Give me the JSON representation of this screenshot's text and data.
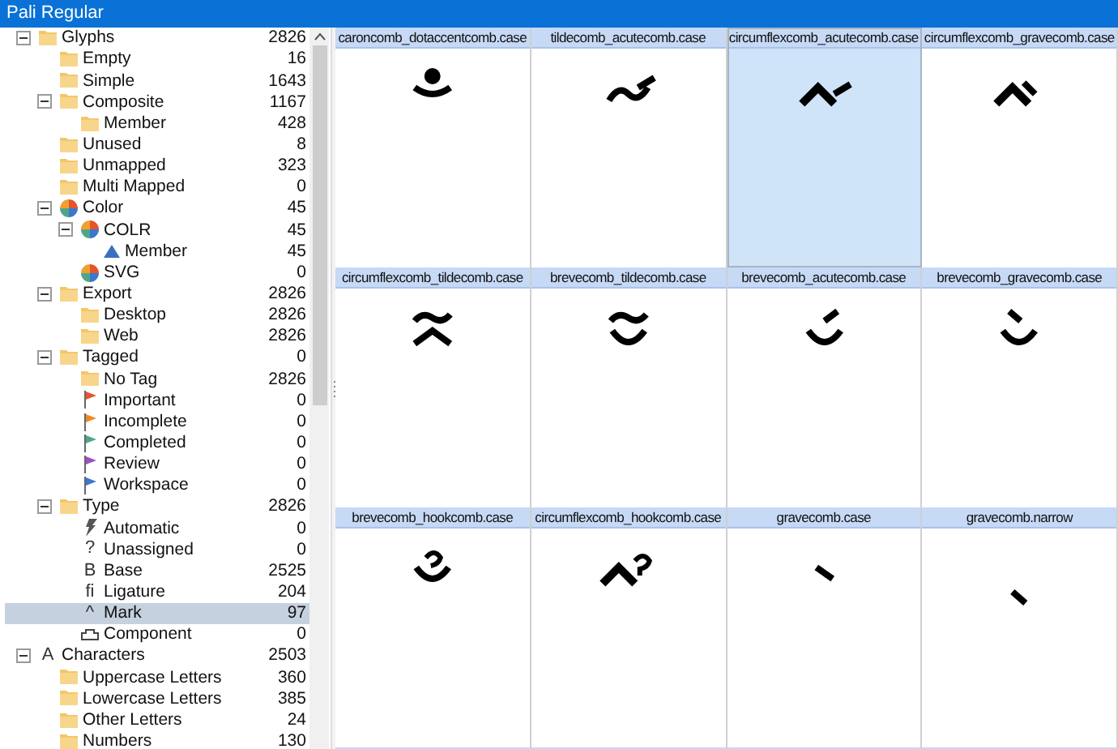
{
  "window": {
    "title": "Pali Regular"
  },
  "tree": [
    {
      "label": "Glyphs",
      "count": "2826",
      "kind": "folder",
      "expanded": true,
      "selected": false,
      "children": [
        {
          "label": "Empty",
          "count": "16",
          "kind": "folder",
          "selected": false
        },
        {
          "label": "Simple",
          "count": "1643",
          "kind": "folder",
          "selected": false
        },
        {
          "label": "Composite",
          "count": "1167",
          "kind": "folder",
          "expanded": true,
          "selected": false,
          "children": [
            {
              "label": "Member",
              "count": "428",
              "kind": "folder",
              "selected": false
            }
          ]
        },
        {
          "label": "Unused",
          "count": "8",
          "kind": "folder",
          "selected": false
        },
        {
          "label": "Unmapped",
          "count": "323",
          "kind": "folder",
          "selected": false
        },
        {
          "label": "Multi Mapped",
          "count": "0",
          "kind": "folder",
          "selected": false
        },
        {
          "label": "Color",
          "count": "45",
          "kind": "color",
          "expanded": true,
          "selected": false,
          "children": [
            {
              "label": "COLR",
              "count": "45",
              "kind": "color",
              "expanded": true,
              "selected": false,
              "children": [
                {
                  "label": "Member",
                  "count": "45",
                  "kind": "triangle",
                  "selected": false
                }
              ]
            },
            {
              "label": "SVG",
              "count": "0",
              "kind": "color",
              "selected": false
            }
          ]
        },
        {
          "label": "Export",
          "count": "2826",
          "kind": "folder",
          "expanded": true,
          "selected": false,
          "children": [
            {
              "label": "Desktop",
              "count": "2826",
              "kind": "folder",
              "selected": false
            },
            {
              "label": "Web",
              "count": "2826",
              "kind": "folder",
              "selected": false
            }
          ]
        },
        {
          "label": "Tagged",
          "count": "0",
          "kind": "folder",
          "expanded": true,
          "selected": false,
          "children": [
            {
              "label": "No Tag",
              "count": "2826",
              "kind": "folder",
              "selected": false
            },
            {
              "label": "Important",
              "count": "0",
              "kind": "flag",
              "color": "#e8532f",
              "selected": false
            },
            {
              "label": "Incomplete",
              "count": "0",
              "kind": "flag",
              "color": "#f08a24",
              "selected": false
            },
            {
              "label": "Completed",
              "count": "0",
              "kind": "flag",
              "color": "#4fa58a",
              "selected": false
            },
            {
              "label": "Review",
              "count": "0",
              "kind": "flag",
              "color": "#9b4fc4",
              "selected": false
            },
            {
              "label": "Workspace",
              "count": "0",
              "kind": "flag",
              "color": "#3a78d0",
              "selected": false
            }
          ]
        },
        {
          "label": "Type",
          "count": "2826",
          "kind": "folder",
          "expanded": true,
          "selected": false,
          "children": [
            {
              "label": "Automatic",
              "count": "0",
              "kind": "bolt",
              "selected": false
            },
            {
              "label": "Unassigned",
              "count": "0",
              "kind": "text",
              "icon_text": "?",
              "selected": false
            },
            {
              "label": "Base",
              "count": "2525",
              "kind": "text",
              "icon_text": "B",
              "selected": false
            },
            {
              "label": "Ligature",
              "count": "204",
              "kind": "text",
              "icon_text": "fi",
              "selected": false
            },
            {
              "label": "Mark",
              "count": "97",
              "kind": "text",
              "icon_text": "^",
              "selected": true
            },
            {
              "label": "Component",
              "count": "0",
              "kind": "component",
              "selected": false
            }
          ]
        }
      ]
    },
    {
      "label": "Characters",
      "count": "2503",
      "kind": "text",
      "icon_text": "A",
      "expanded": true,
      "selected": false,
      "children": [
        {
          "label": "Uppercase Letters",
          "count": "360",
          "kind": "folder",
          "selected": false
        },
        {
          "label": "Lowercase Letters",
          "count": "385",
          "kind": "folder",
          "selected": false
        },
        {
          "label": "Other Letters",
          "count": "24",
          "kind": "folder",
          "selected": false
        },
        {
          "label": "Numbers",
          "count": "130",
          "kind": "folder",
          "selected": false
        }
      ]
    }
  ],
  "glyphs": [
    {
      "name": "caroncomb_dotaccentcomb.case",
      "selected": false
    },
    {
      "name": "tildecomb_acutecomb.case",
      "selected": false
    },
    {
      "name": "circumflexcomb_acutecomb.case",
      "selected": true
    },
    {
      "name": "circumflexcomb_gravecomb.case",
      "selected": false
    },
    {
      "name": "circumflexcomb_tildecomb.case",
      "selected": false
    },
    {
      "name": "brevecomb_tildecomb.case",
      "selected": false
    },
    {
      "name": "brevecomb_acutecomb.case",
      "selected": false
    },
    {
      "name": "brevecomb_gravecomb.case",
      "selected": false
    },
    {
      "name": "brevecomb_hookcomb.case",
      "selected": false
    },
    {
      "name": "circumflexcomb_hookcomb.case",
      "selected": false
    },
    {
      "name": "gravecomb.case",
      "selected": false
    },
    {
      "name": "gravecomb.narrow",
      "selected": false
    }
  ]
}
